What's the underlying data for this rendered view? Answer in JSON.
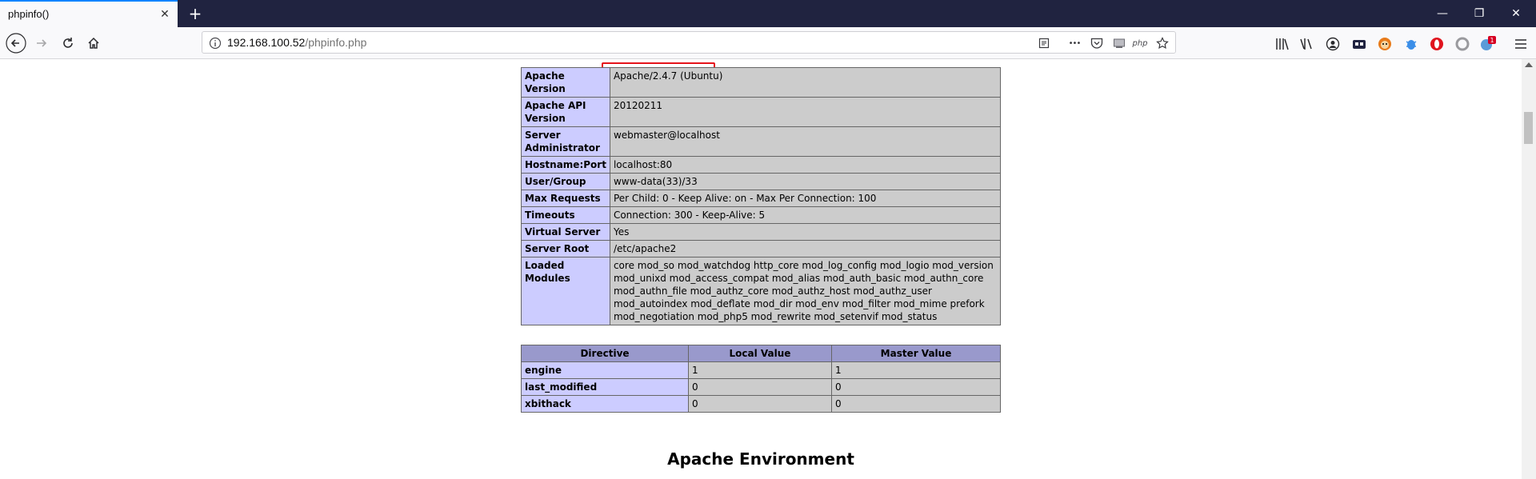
{
  "browser": {
    "tab_title": "phpinfo()",
    "tab_close": "✕",
    "new_tab": "+",
    "window_controls": {
      "minimize": "—",
      "restore": "❐",
      "close": "✕"
    },
    "url_host": "192.168.100.52",
    "url_path": "/phpinfo.php",
    "url_actions": {
      "php_label": "php",
      "more": "•••"
    },
    "notification_badge": "1",
    "icons": [
      "back-icon",
      "forward-icon",
      "reload-icon",
      "home-icon",
      "info-icon",
      "reader-view-icon",
      "more-icon",
      "pocket-icon",
      "screenshot-icon",
      "php-icon",
      "bookmark-star-icon",
      "library-icon",
      "sidebar-icon",
      "account-icon",
      "extension-icon",
      "extension-icon",
      "extension-icon",
      "extension-icon",
      "extension-icon",
      "extension-icon",
      "menu-icon"
    ]
  },
  "apache_table": {
    "rows": [
      {
        "key": "Apache Version",
        "value": "Apache/2.4.7 (Ubuntu)"
      },
      {
        "key": "Apache API Version",
        "value": "20120211"
      },
      {
        "key": "Server Administrator",
        "value": "webmaster@localhost"
      },
      {
        "key": "Hostname:Port",
        "value": "localhost:80"
      },
      {
        "key": "User/Group",
        "value": "www-data(33)/33"
      },
      {
        "key": "Max Requests",
        "value": "Per Child: 0 - Keep Alive: on - Max Per Connection: 100"
      },
      {
        "key": "Timeouts",
        "value": "Connection: 300 - Keep-Alive: 5"
      },
      {
        "key": "Virtual Server",
        "value": "Yes"
      },
      {
        "key": "Server Root",
        "value": "/etc/apache2"
      },
      {
        "key": "Loaded Modules",
        "value": "core mod_so mod_watchdog http_core mod_log_config mod_logio mod_version mod_unixd mod_access_compat mod_alias mod_auth_basic mod_authn_core mod_authn_file mod_authz_core mod_authz_host mod_authz_user mod_autoindex mod_deflate mod_dir mod_env mod_filter mod_mime prefork mod_negotiation mod_php5 mod_rewrite mod_setenvif mod_status"
      }
    ]
  },
  "directive_table": {
    "headers": [
      "Directive",
      "Local Value",
      "Master Value"
    ],
    "rows": [
      [
        "engine",
        "1",
        "1"
      ],
      [
        "last_modified",
        "0",
        "0"
      ],
      [
        "xbithack",
        "0",
        "0"
      ]
    ]
  },
  "section_title": "Apache Environment",
  "colors": {
    "tabstrip": "#202340",
    "key_cell": "#ccccff",
    "value_cell": "#cccccc",
    "header_cell": "#9999cc",
    "highlight": "#e5141b"
  }
}
